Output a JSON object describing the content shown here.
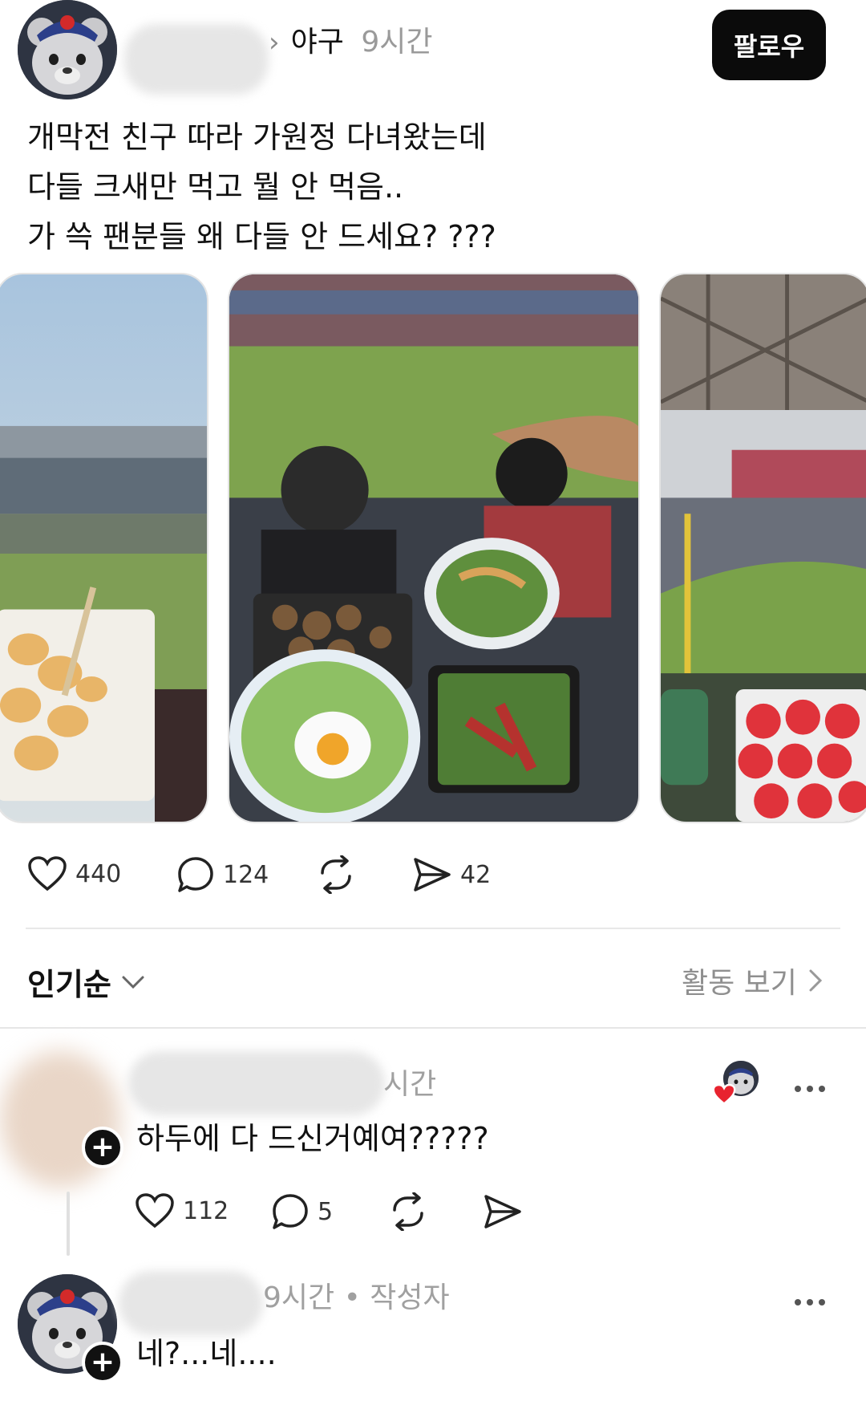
{
  "post": {
    "topic_prefix": "›",
    "topic": "야구",
    "time": "9시간",
    "follow_label": "팔로우",
    "lines": [
      "개막전 친구 따라 가원정 다녀왔는데",
      "다들 크새만 먹고 뭘 안 먹음..",
      "가 쓱 팬분들 왜 다들 안 드세요? ???"
    ],
    "stats": {
      "likes": "440",
      "comments": "124",
      "shares": "42"
    }
  },
  "sort": {
    "label": "인기순",
    "activity_label": "활동 보기"
  },
  "comments": [
    {
      "time": "시간",
      "text": "하두에 다 드신거예여?????",
      "likes": "112",
      "replies": "5"
    },
    {
      "time": "9시간 • 작성자",
      "text": "네?...네...."
    }
  ],
  "icons": {
    "like": "heart-icon",
    "comment": "comment-bubble-icon",
    "repost": "repost-icon",
    "share": "send-icon",
    "more": "more-dots-icon",
    "plus": "plus-icon",
    "chevron_down": "chevron-down-icon",
    "chevron_right": "chevron-right-icon"
  },
  "colors": {
    "follow_bg": "#0b0b0b",
    "muted_text": "#9a9a9a",
    "heart_red": "#e8232f"
  }
}
